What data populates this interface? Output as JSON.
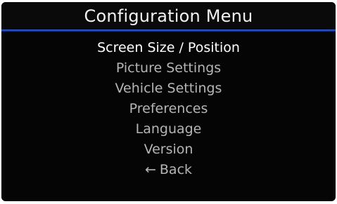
{
  "header": {
    "title": "Configuration Menu"
  },
  "menu": {
    "items": [
      {
        "label": "Screen Size / Position",
        "selected": true
      },
      {
        "label": "Picture Settings",
        "selected": false
      },
      {
        "label": "Vehicle Settings",
        "selected": false
      },
      {
        "label": "Preferences",
        "selected": false
      },
      {
        "label": "Language",
        "selected": false
      },
      {
        "label": "Version",
        "selected": false
      }
    ],
    "back": {
      "icon": "back-arrow-icon",
      "icon_glyph": "←",
      "label": "Back"
    }
  },
  "colors": {
    "background": "#050505",
    "accent_line": "#1d44ad",
    "selected_text": "#ffffff",
    "normal_text": "#b5b5b5",
    "title_text": "#f2f2f2"
  }
}
